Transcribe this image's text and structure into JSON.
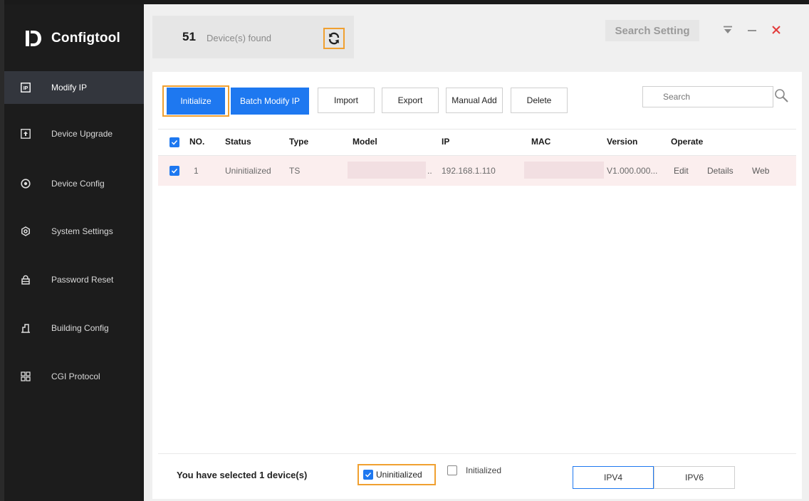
{
  "app": {
    "name": "Configtool"
  },
  "sidebar": {
    "items": [
      {
        "label": "Modify IP",
        "icon": "ip-icon",
        "active": true
      },
      {
        "label": "Device Upgrade",
        "icon": "upload-icon"
      },
      {
        "label": "Device Config",
        "icon": "config-circle-icon"
      },
      {
        "label": "System Settings",
        "icon": "settings-icon"
      },
      {
        "label": "Password Reset",
        "icon": "lock-icon"
      },
      {
        "label": "Building Config",
        "icon": "building-icon"
      },
      {
        "label": "CGI Protocol",
        "icon": "grid-icon"
      }
    ]
  },
  "header": {
    "count": "51",
    "count_label": "Device(s) found",
    "search_setting": "Search Setting"
  },
  "toolbar": {
    "initialize": "Initialize",
    "batch_modify_ip": "Batch Modify IP",
    "import": "Import",
    "export": "Export",
    "manual_add": "Manual Add",
    "delete": "Delete",
    "search_placeholder": "Search"
  },
  "table": {
    "columns": [
      "NO.",
      "Status",
      "Type",
      "Model",
      "IP",
      "MAC",
      "Version",
      "Operate"
    ],
    "rows": [
      {
        "no": "1",
        "status": "Uninitialized",
        "type": "TS",
        "model_suffix": "..",
        "ip": "192.168.1.110",
        "version": "V1.000.000...",
        "actions": [
          "Edit",
          "Details",
          "Web"
        ]
      }
    ]
  },
  "footer": {
    "selected_text": "You have selected 1  device(s)",
    "filter_uninitialized": "Uninitialized",
    "filter_initialized": "Initialized",
    "ipv4": "IPV4",
    "ipv6": "IPV6"
  },
  "colors": {
    "accent": "#1e78f0",
    "highlight": "#f0a030",
    "sidebar": "#1c1c1c",
    "close": "#e23a3a"
  }
}
